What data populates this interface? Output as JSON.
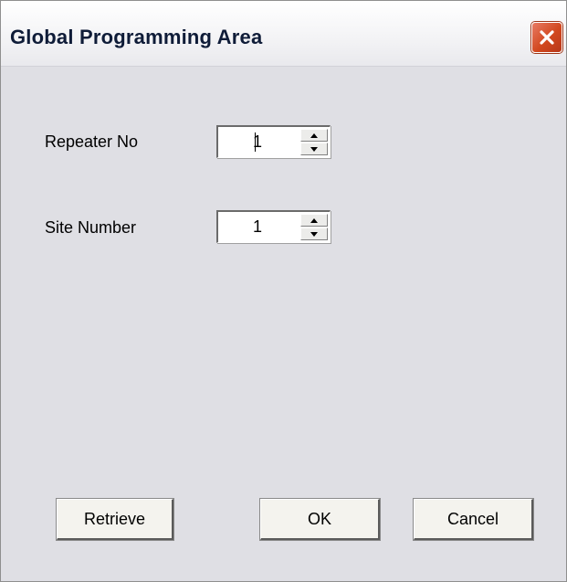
{
  "window": {
    "title": "Global Programming Area"
  },
  "icons": {
    "close": "close-icon",
    "spin_up": "spin-up-arrow-icon",
    "spin_down": "spin-down-arrow-icon"
  },
  "fields": {
    "repeater_no": {
      "label": "Repeater No",
      "value": "1"
    },
    "site_number": {
      "label": "Site Number",
      "value": "1"
    }
  },
  "buttons": {
    "retrieve": "Retrieve",
    "ok": "OK",
    "cancel": "Cancel"
  },
  "colors": {
    "dialog_background": "#dfdfe4",
    "close_button": "#d2481f"
  }
}
